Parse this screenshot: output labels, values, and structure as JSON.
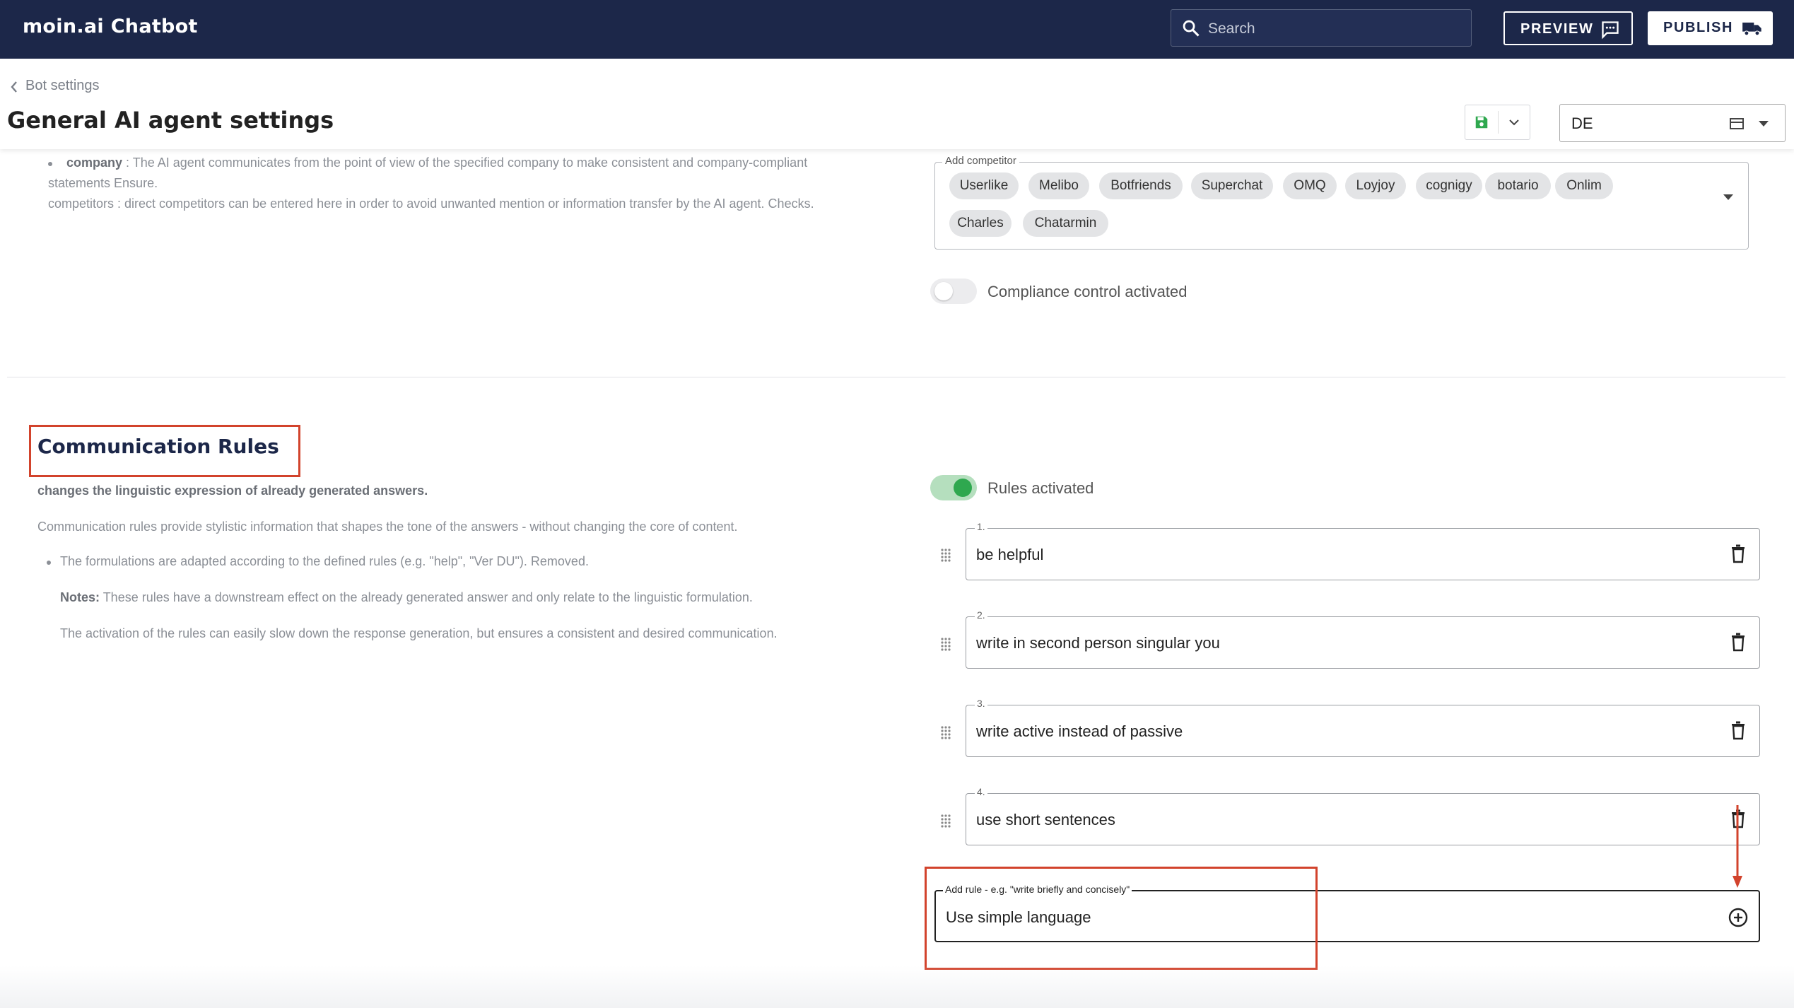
{
  "header": {
    "brand": "moin.ai Chatbot",
    "search_placeholder": "Search",
    "preview_label": "PREVIEW",
    "publish_label": "PUBLISH"
  },
  "subheader": {
    "back_label": "Bot settings",
    "title": "General AI agent settings",
    "language": "DE"
  },
  "top_section": {
    "company_term": "company",
    "company_line1": " : The AI agent communicates from the point of view of the specified company to make consistent and company-compliant",
    "company_line2": "statements Ensure.",
    "competitors_line": "competitors : direct competitors can be entered here in order to avoid unwanted mention or information transfer by the AI agent. Checks.",
    "competitor_field_label": "Add competitor",
    "competitors": [
      "Userlike",
      "Melibo",
      "Botfriends",
      "Superchat",
      "OMQ",
      "Loyjoy",
      "cognigy",
      "botario",
      "Onlim",
      "Charles",
      "Chatarmin"
    ],
    "compliance_label": "Compliance control activated",
    "compliance_on": false
  },
  "communication_rules": {
    "title": "Communication Rules",
    "subtitle": "changes the linguistic expression of already generated answers.",
    "intro": "Communication rules provide stylistic information that shapes the tone of the answers - without changing the core of content.",
    "bullet": "The formulations are adapted according to the defined rules (e.g. \"help\", \"Ver DU\"). Removed.",
    "notes_label": "Notes:",
    "notes_text": " These rules have a downstream effect on the already generated answer and only relate to the linguistic formulation.",
    "activation_note": "The activation of the rules can easily slow down the response generation, but ensures a consistent and desired communication.",
    "rules_toggle_label": "Rules activated",
    "rules_on": true,
    "rules": [
      {
        "num": "1.",
        "text": "be helpful"
      },
      {
        "num": "2.",
        "text": "write in second person singular you"
      },
      {
        "num": "3.",
        "text": "write active instead of passive"
      },
      {
        "num": "4.",
        "text": "use short sentences"
      }
    ],
    "add_rule_label": "Add rule - e.g. \"write briefly and concisely\"",
    "add_rule_value": "Use simple language"
  },
  "colors": {
    "header_bg": "#1c2749",
    "accent_green": "#2fa84f",
    "highlight_red": "#d2432c"
  }
}
